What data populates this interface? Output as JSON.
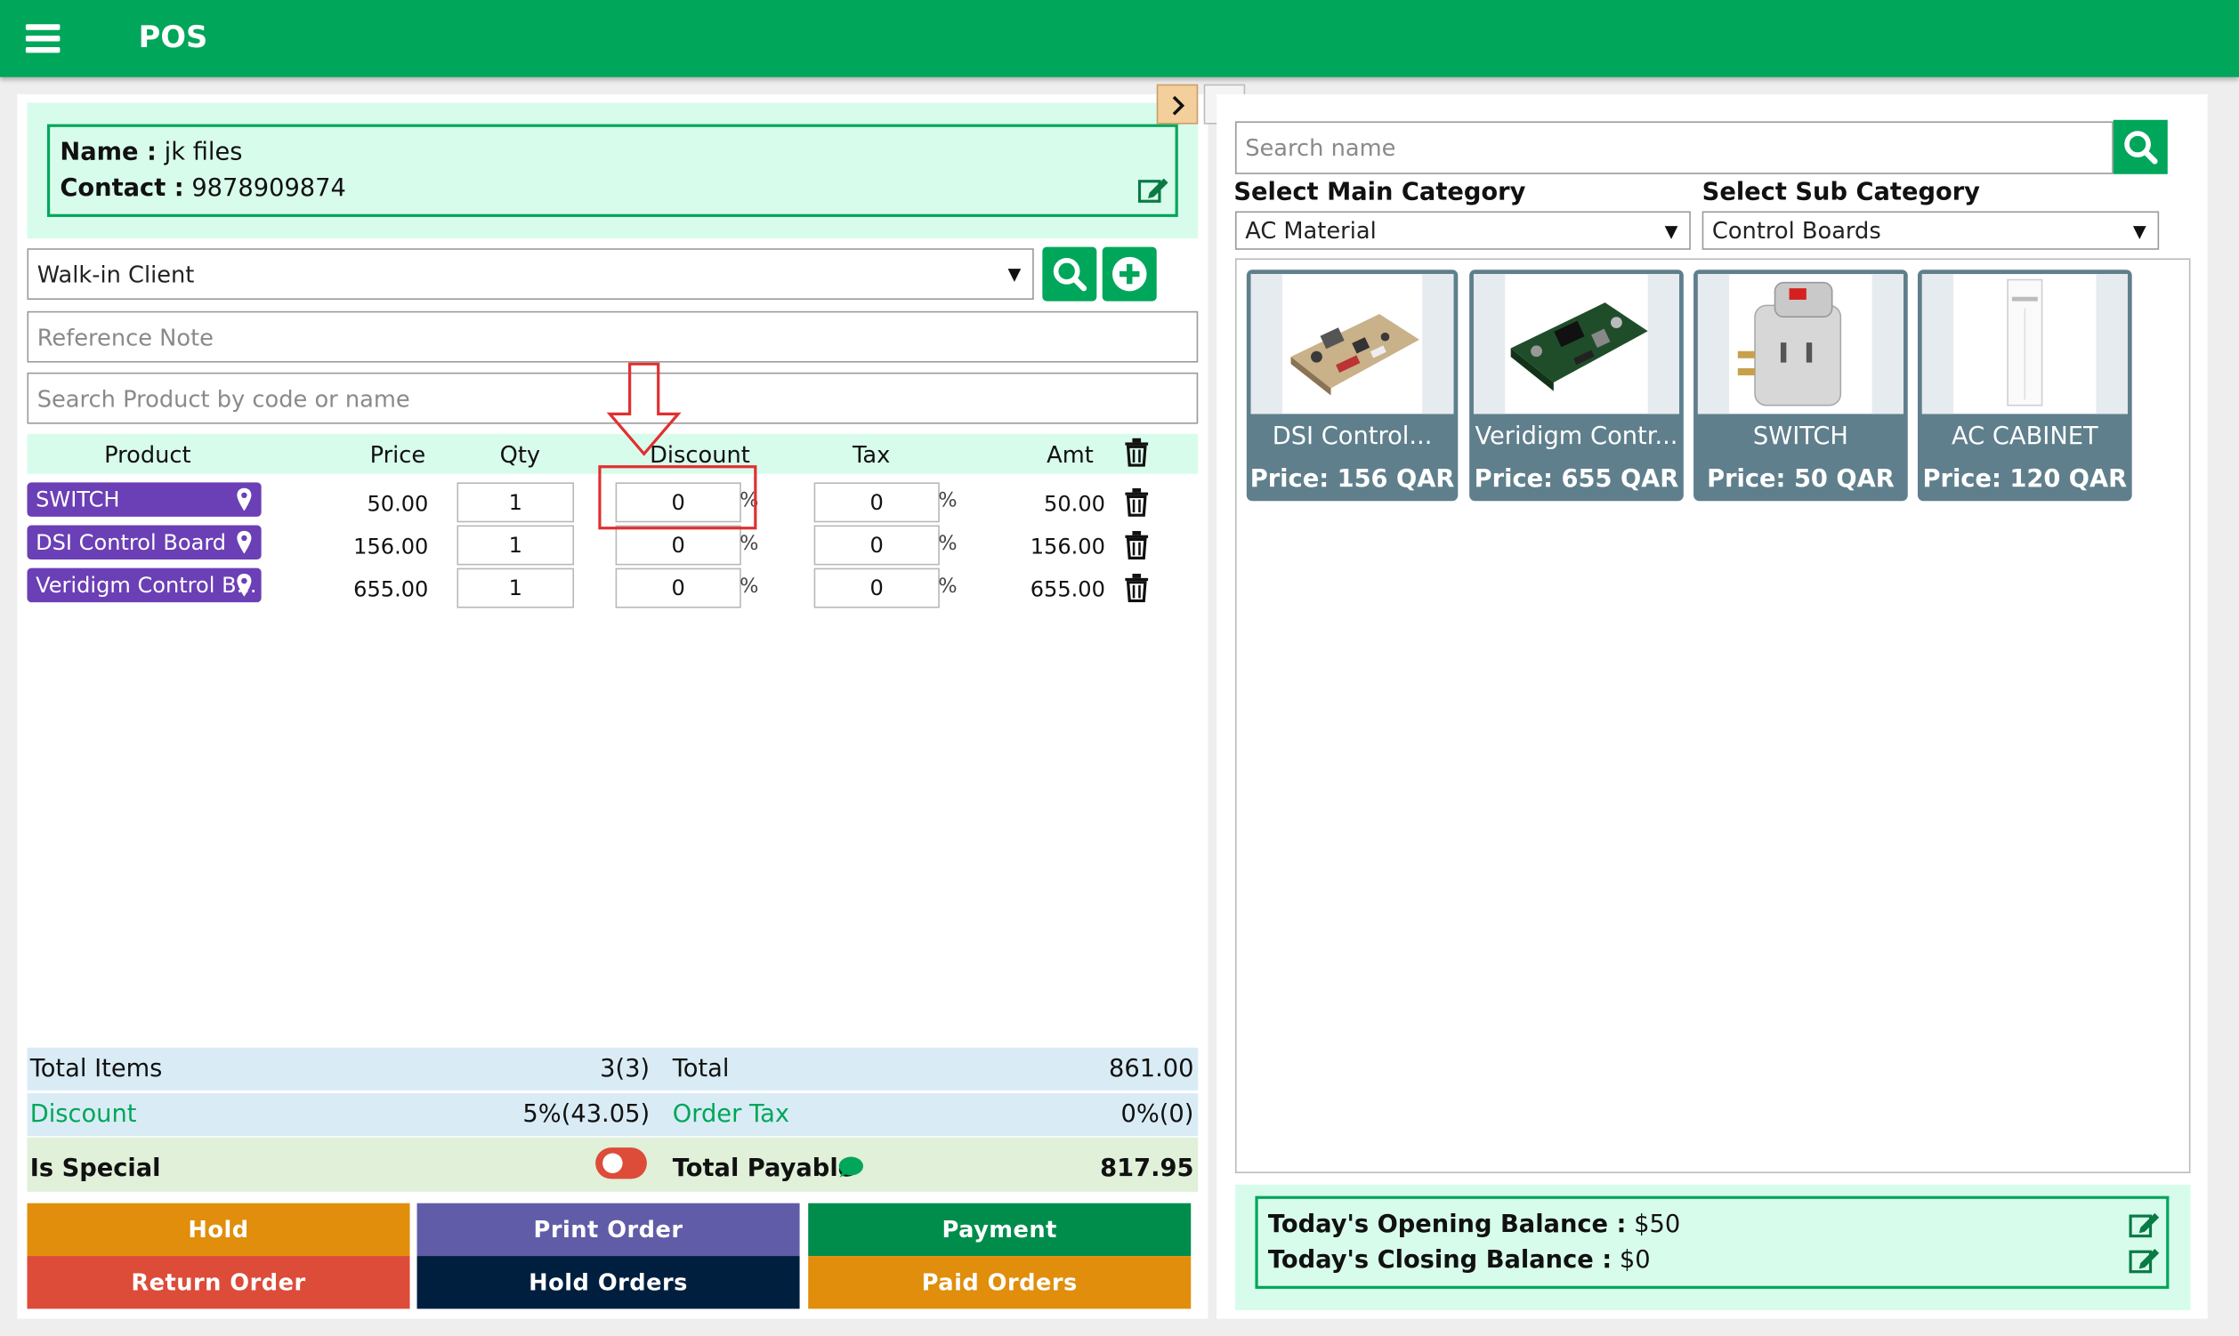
{
  "app": {
    "title": "POS"
  },
  "customer": {
    "name_label": "Name :",
    "name_value": "jk files",
    "contact_label": "Contact :",
    "contact_value": "9878909874"
  },
  "client_select": {
    "value": "Walk-in Client"
  },
  "reference": {
    "placeholder": "Reference Note"
  },
  "product_search": {
    "placeholder": "Search Product by code or name"
  },
  "table": {
    "headers": {
      "product": "Product",
      "price": "Price",
      "qty": "Qty",
      "discount": "Discount",
      "tax": "Tax",
      "amt": "Amt"
    },
    "rows": [
      {
        "product": "SWITCH",
        "price": "50.00",
        "qty": "1",
        "discount": "0",
        "discount_unit": "%",
        "tax": "0",
        "tax_unit": "%",
        "amt": "50.00"
      },
      {
        "product": "DSI Control Board",
        "price": "156.00",
        "qty": "1",
        "discount": "0",
        "discount_unit": "%",
        "tax": "0",
        "tax_unit": "%",
        "amt": "156.00"
      },
      {
        "product": "Veridigm Control B...",
        "price": "655.00",
        "qty": "1",
        "discount": "0",
        "discount_unit": "%",
        "tax": "0",
        "tax_unit": "%",
        "amt": "655.00"
      }
    ]
  },
  "summary": {
    "total_items_label": "Total Items",
    "total_items_value": "3(3)",
    "total_label": "Total",
    "total_value": "861.00",
    "discount_label": "Discount",
    "discount_value": "5%(43.05)",
    "order_tax_label": "Order Tax",
    "order_tax_value": "0%(0)",
    "is_special_label": "Is Special",
    "total_payable_label": "Total Payable",
    "total_payable_value": "817.95"
  },
  "actions": {
    "hold": "Hold",
    "print_order": "Print Order",
    "payment": "Payment",
    "return_order": "Return Order",
    "hold_orders": "Hold Orders",
    "paid_orders": "Paid Orders"
  },
  "right": {
    "search_placeholder": "Search name",
    "main_category_label": "Select Main Category",
    "main_category_value": "AC Material",
    "sub_category_label": "Select Sub Category",
    "sub_category_value": "Control Boards",
    "products": [
      {
        "name": "DSI Control...",
        "price": "Price: 156 QAR",
        "icon": "circuit-board-image"
      },
      {
        "name": "Veridigm Contr...",
        "price": "Price: 655 QAR",
        "icon": "green-circuit-board-image"
      },
      {
        "name": "SWITCH",
        "price": "Price: 50 QAR",
        "icon": "switch-adapter-image"
      },
      {
        "name": "AC CABINET",
        "price": "Price: 120 QAR",
        "icon": "ac-cabinet-image"
      }
    ],
    "opening_label": "Today's Opening Balance :",
    "opening_value": "$50",
    "closing_label": "Today's Closing Balance :",
    "closing_value": "$0"
  },
  "colors": {
    "brand_green": "#00a65a",
    "purple": "#6b3fb5",
    "orange": "#e08e0b",
    "indigo": "#605ca8",
    "red": "#dd4b39",
    "navy": "#001f3f",
    "mint": "#d8fcec",
    "light_blue": "#d9ecf5",
    "light_green": "#e0f0d9",
    "card_slate": "#5f7f8c",
    "annotation_red": "#e03030"
  }
}
